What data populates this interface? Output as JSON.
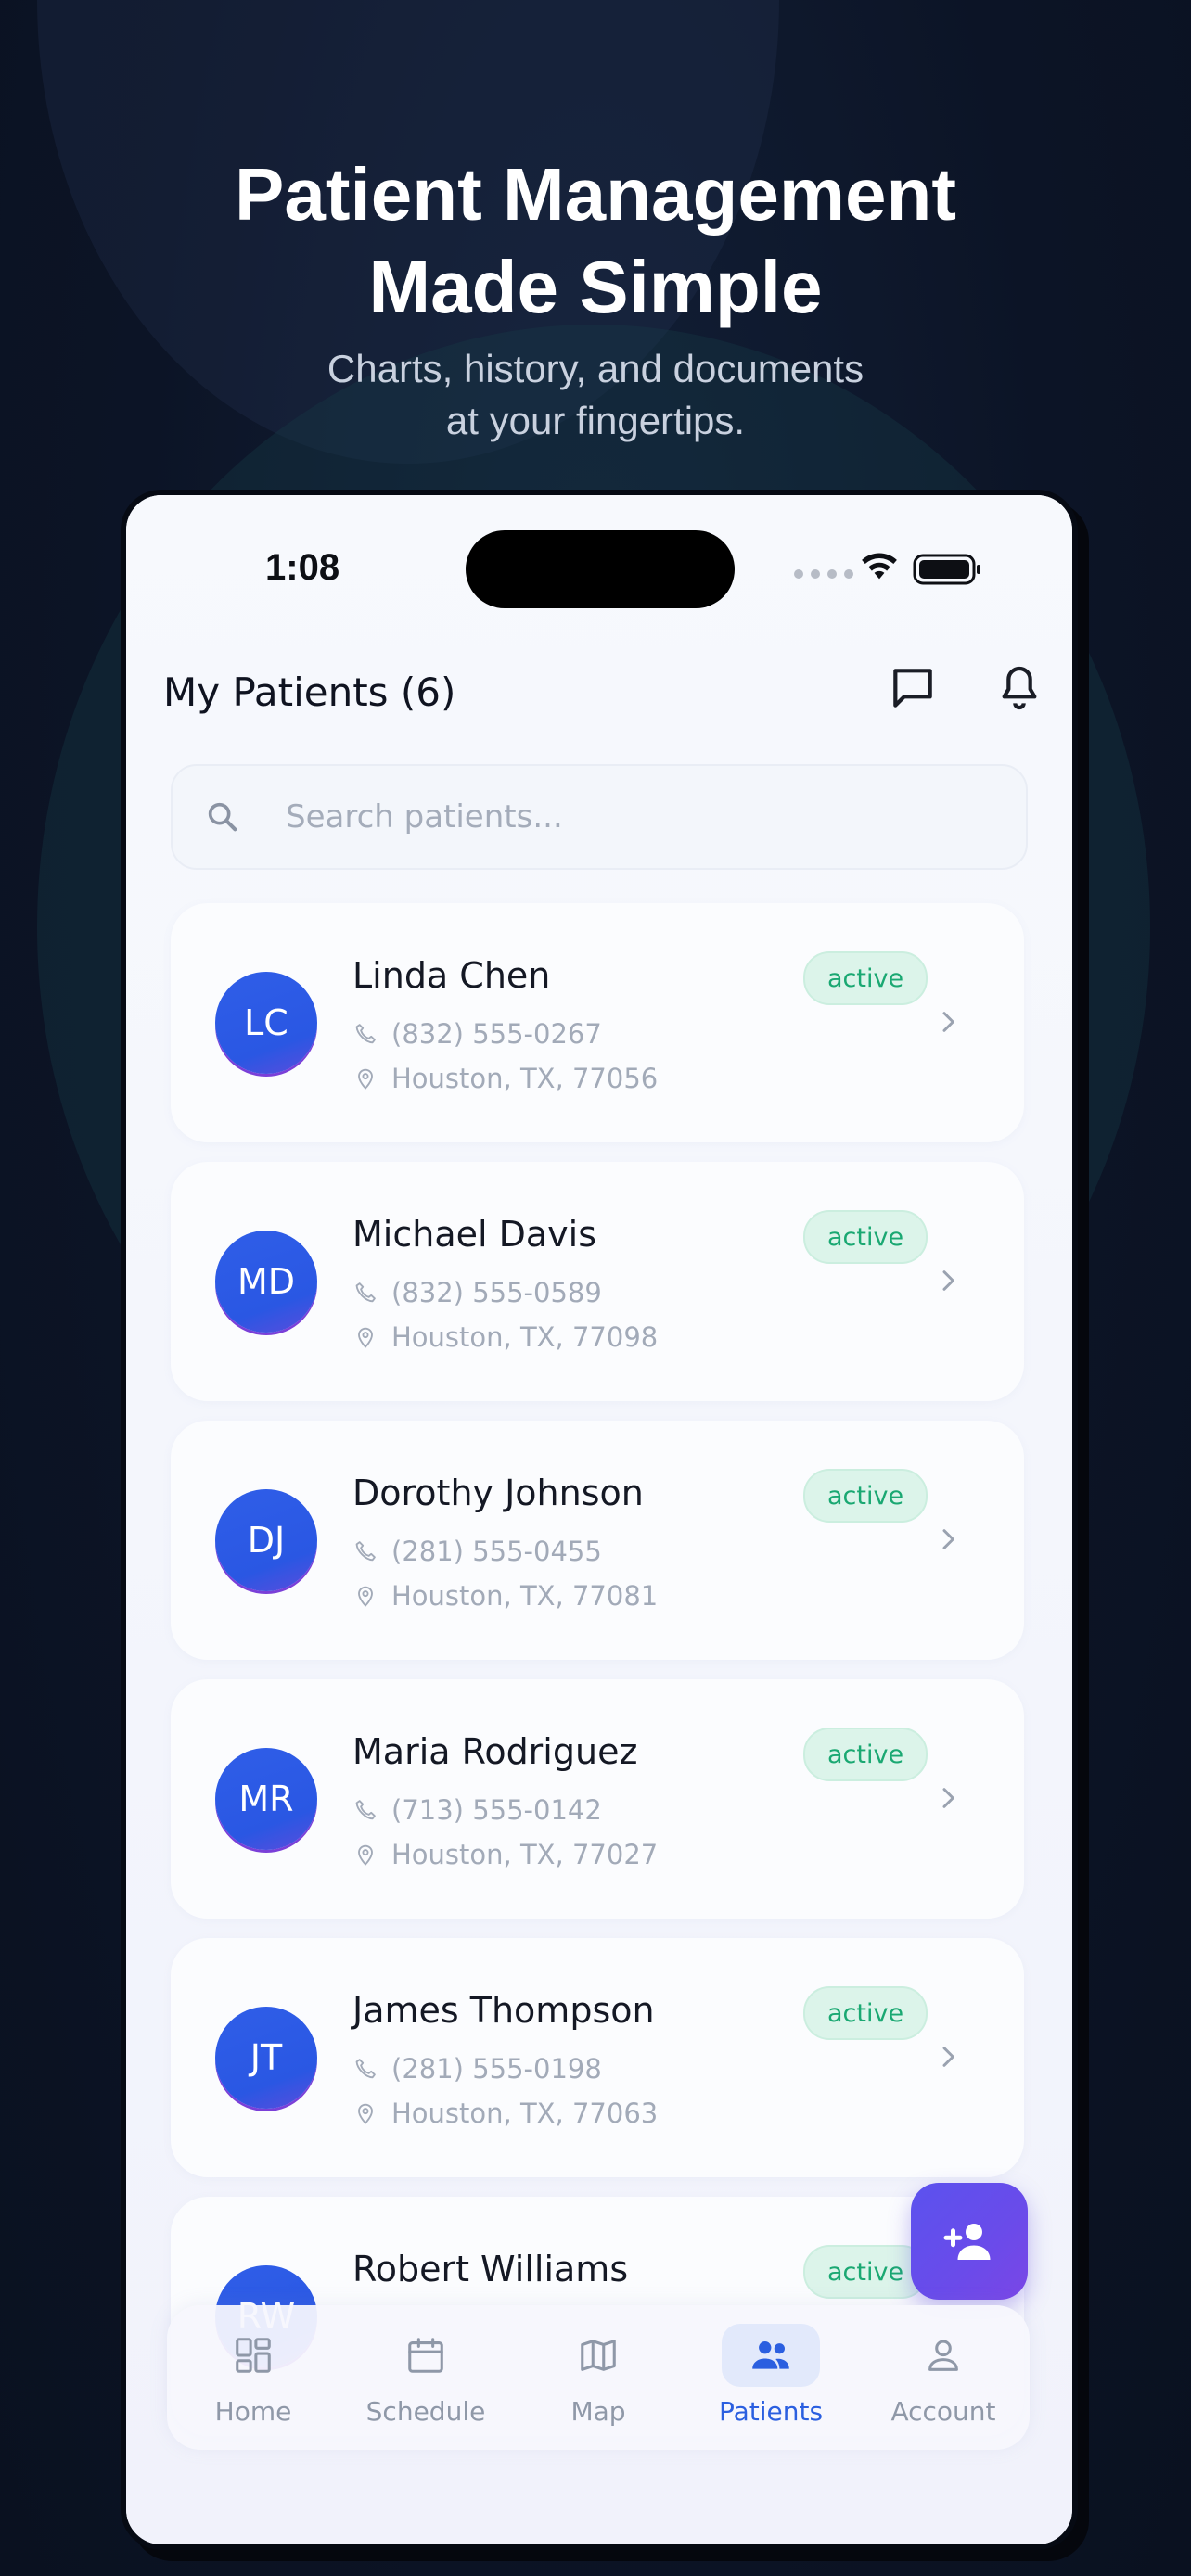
{
  "hero": {
    "title_line1": "Patient Management",
    "title_line2": "Made Simple",
    "subtitle_line1": "Charts, history, and documents",
    "subtitle_line2": "at your fingertips."
  },
  "status_bar": {
    "time": "1:08"
  },
  "header": {
    "title": "My Patients (6)"
  },
  "search": {
    "placeholder": "Search patients..."
  },
  "patients": [
    {
      "initials": "LC",
      "name": "Linda Chen",
      "phone": "(832) 555-0267",
      "address": "Houston, TX, 77056",
      "status": "active"
    },
    {
      "initials": "MD",
      "name": "Michael Davis",
      "phone": "(832) 555-0589",
      "address": "Houston, TX, 77098",
      "status": "active"
    },
    {
      "initials": "DJ",
      "name": "Dorothy Johnson",
      "phone": "(281) 555-0455",
      "address": "Houston, TX, 77081",
      "status": "active"
    },
    {
      "initials": "MR",
      "name": "Maria Rodriguez",
      "phone": "(713) 555-0142",
      "address": "Houston, TX, 77027",
      "status": "active"
    },
    {
      "initials": "JT",
      "name": "James Thompson",
      "phone": "(281) 555-0198",
      "address": "Houston, TX, 77063",
      "status": "active"
    },
    {
      "initials": "RW",
      "name": "Robert Williams",
      "status": "active"
    }
  ],
  "tabs": [
    {
      "label": "Home",
      "icon": "dashboard-icon"
    },
    {
      "label": "Schedule",
      "icon": "calendar-icon"
    },
    {
      "label": "Map",
      "icon": "map-icon"
    },
    {
      "label": "Patients",
      "icon": "people-icon",
      "active": true
    },
    {
      "label": "Account",
      "icon": "person-icon"
    }
  ],
  "colors": {
    "accent": "#2b5fe0",
    "status_active": "#1aa872",
    "fab": "#6a4bea"
  }
}
